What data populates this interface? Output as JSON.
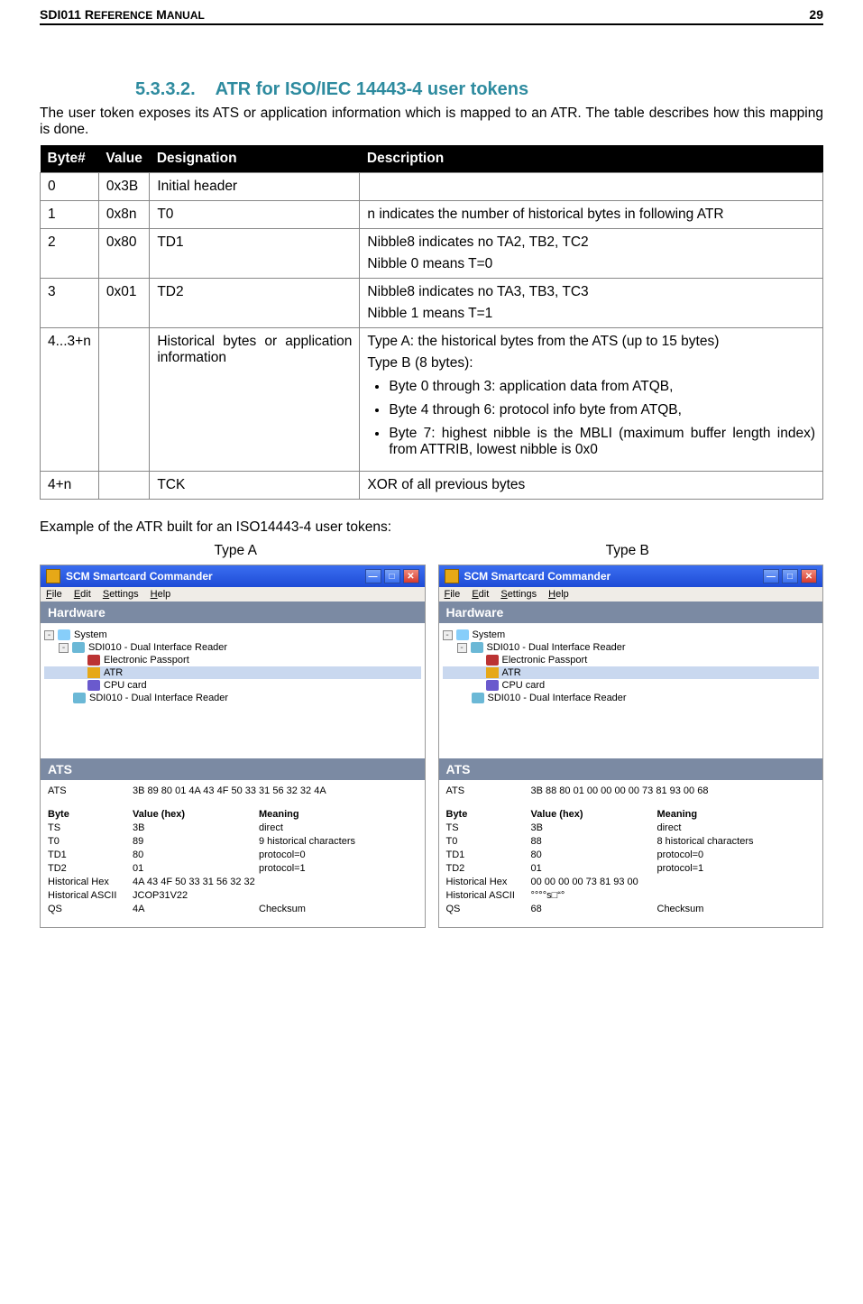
{
  "header": {
    "left": "SDI011 REFERENCE MANUAL",
    "right": "29"
  },
  "section": {
    "num": "5.3.3.2.",
    "title": "ATR for ISO/IEC 14443-4 user tokens"
  },
  "intro": "The user token exposes its ATS or application information which is mapped to an ATR. The table describes how this mapping is done.",
  "table": {
    "headers": [
      "Byte#",
      "Value",
      "Designation",
      "Description"
    ],
    "rows": [
      {
        "byte": "0",
        "value": "0x3B",
        "desig": "Initial header",
        "desc_lines": []
      },
      {
        "byte": "1",
        "value": "0x8n",
        "desig": "T0",
        "desc_lines": [
          "n indicates the number of historical bytes in following ATR"
        ]
      },
      {
        "byte": "2",
        "value": "0x80",
        "desig": "TD1",
        "desc_lines": [
          "Nibble8 indicates no TA2, TB2, TC2",
          "Nibble 0 means T=0"
        ]
      },
      {
        "byte": "3",
        "value": "0x01",
        "desig": "TD2",
        "desc_lines": [
          "Nibble8 indicates no TA3, TB3, TC3",
          "Nibble 1 means T=1"
        ]
      },
      {
        "byte": "4...3+n",
        "value": "",
        "desig": "Historical bytes or application information",
        "desc_lines": [
          "Type A: the historical bytes from the ATS (up to 15 bytes)",
          "Type B (8 bytes):"
        ],
        "bullets": [
          "Byte 0 through 3: application data from ATQB,",
          "Byte 4 through 6: protocol info byte from ATQB,",
          "Byte 7: highest nibble is the MBLI (maximum buffer length index) from ATTRIB, lowest nibble is 0x0"
        ]
      },
      {
        "byte": "4+n",
        "value": "",
        "desig": "TCK",
        "desc_lines": [
          "XOR of all previous bytes"
        ]
      }
    ]
  },
  "example_note": "Example of the ATR built for an ISO14443-4 user tokens:",
  "type_labels": {
    "a": "Type A",
    "b": "Type B"
  },
  "commander": {
    "title": "SCM Smartcard Commander",
    "menus": [
      "File",
      "Edit",
      "Settings",
      "Help"
    ],
    "panel_hardware": "Hardware",
    "panel_ats": "ATS",
    "tree": {
      "system": "System",
      "reader1": "SDI010 - Dual Interface Reader",
      "passport": "Electronic Passport",
      "atr": "ATR",
      "cpu": "CPU card",
      "reader2": "SDI010 - Dual Interface Reader"
    },
    "grid_headers": {
      "byte": "Byte",
      "value": "Value (hex)",
      "meaning": "Meaning"
    }
  },
  "shotA": {
    "ats_label": "ATS",
    "ats_value": "3B 89 80 01 4A 43 4F 50 33 31 56 32 32 4A",
    "rows": [
      {
        "b": "TS",
        "v": "3B",
        "m": "direct"
      },
      {
        "b": "T0",
        "v": "89",
        "m": "9 historical characters"
      },
      {
        "b": "TD1",
        "v": "80",
        "m": "protocol=0"
      },
      {
        "b": "TD2",
        "v": "01",
        "m": "protocol=1"
      },
      {
        "b": "Historical Hex",
        "v": "4A 43 4F 50 33 31 56 32 32",
        "m": ""
      },
      {
        "b": "Historical ASCII",
        "v": "JCOP31V22",
        "m": ""
      },
      {
        "b": "QS",
        "v": "4A",
        "m": "Checksum"
      }
    ]
  },
  "shotB": {
    "ats_label": "ATS",
    "ats_value": "3B 88 80 01 00 00 00 00 73 81 93 00 68",
    "rows": [
      {
        "b": "TS",
        "v": "3B",
        "m": "direct"
      },
      {
        "b": "T0",
        "v": "88",
        "m": "8 historical characters"
      },
      {
        "b": "TD1",
        "v": "80",
        "m": "protocol=0"
      },
      {
        "b": "TD2",
        "v": "01",
        "m": "protocol=1"
      },
      {
        "b": "Historical Hex",
        "v": "00 00 00 00 73 81 93 00",
        "m": ""
      },
      {
        "b": "Historical ASCII",
        "v": "°°°°s□“°",
        "m": ""
      },
      {
        "b": "QS",
        "v": "68",
        "m": "Checksum"
      }
    ]
  }
}
